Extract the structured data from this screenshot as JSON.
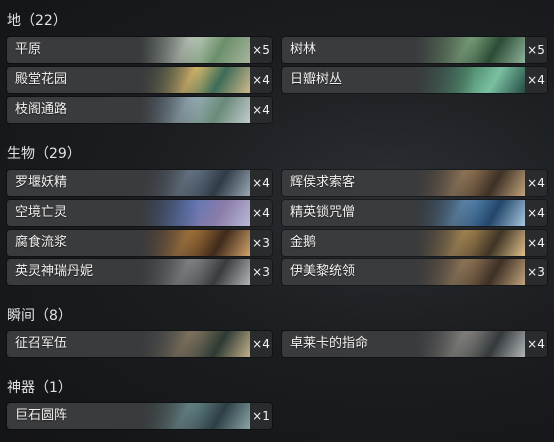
{
  "sections": {
    "lands": {
      "title": "地（22）",
      "cards": [
        {
          "name": "平原",
          "count": "×5"
        },
        {
          "name": "树林",
          "count": "×5"
        },
        {
          "name": "殿堂花园",
          "count": "×4"
        },
        {
          "name": "日瓣树丛",
          "count": "×4"
        },
        {
          "name": "枝阁通路",
          "count": "×4"
        }
      ]
    },
    "creatures": {
      "title": "生物（29）",
      "cards": [
        {
          "name": "罗堰妖精",
          "count": "×4"
        },
        {
          "name": "辉侯求索客",
          "count": "×4"
        },
        {
          "name": "空境亡灵",
          "count": "×4"
        },
        {
          "name": "精英锁咒僧",
          "count": "×4"
        },
        {
          "name": "腐食流浆",
          "count": "×3"
        },
        {
          "name": "金鹅",
          "count": "×4"
        },
        {
          "name": "英灵神瑞丹妮",
          "count": "×3"
        },
        {
          "name": "伊美黎统领",
          "count": "×3"
        }
      ]
    },
    "instants": {
      "title": "瞬间（8）",
      "cards": [
        {
          "name": "征召军伍",
          "count": "×4"
        },
        {
          "name": "卓莱卡的指命",
          "count": "×4"
        }
      ]
    },
    "artifacts": {
      "title": "神器（1）",
      "cards": [
        {
          "name": "巨石圆阵",
          "count": "×1"
        }
      ]
    }
  }
}
